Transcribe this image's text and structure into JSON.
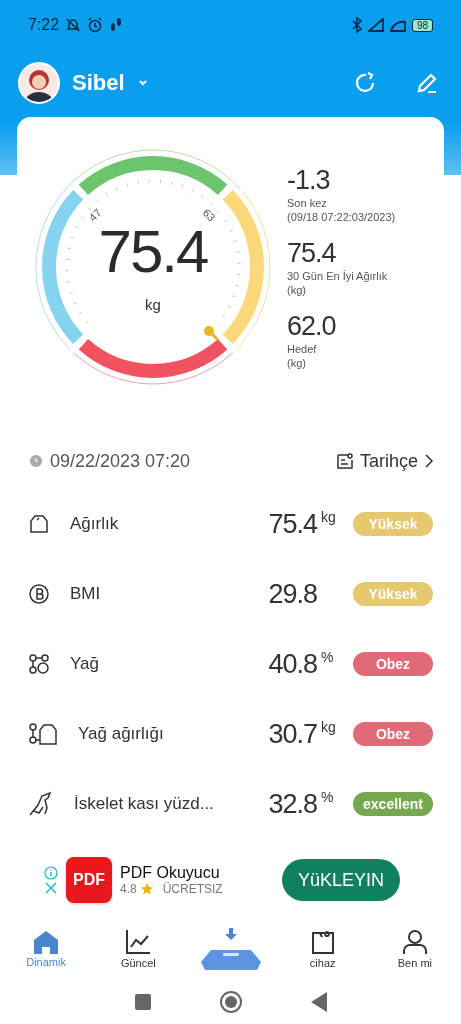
{
  "status_bar": {
    "time": "7:22",
    "battery": "98"
  },
  "header": {
    "user_name": "Sibel"
  },
  "gauge": {
    "value": "75.4",
    "unit": "kg",
    "tick_labels": [
      "47",
      "63"
    ]
  },
  "stats": [
    {
      "value": "-1.3",
      "label": "Son kez",
      "note": "(09/18 07:22:03/2023)"
    },
    {
      "value": "75.4",
      "label": "30 Gün En İyi Ağırlık",
      "note": "(kg)"
    },
    {
      "value": "62.0",
      "label": "Hedef",
      "note": "(kg)"
    }
  ],
  "measurement": {
    "date": "09/22/2023 07:20",
    "history_link": "Tarihçe"
  },
  "metrics": [
    {
      "kind": "weight",
      "label": "Ağırlık",
      "value": "75.4",
      "unit": "kg",
      "badge": "Yüksek",
      "color": "#e6c86e"
    },
    {
      "kind": "bmi",
      "label": "BMI",
      "value": "29.8",
      "badge": "Yüksek",
      "color": "#e6c86e"
    },
    {
      "kind": "fat",
      "label": "Yağ",
      "value": "40.8",
      "unit": "%",
      "badge": "Obez",
      "color": "#e06a76"
    },
    {
      "kind": "fatweight",
      "label": "Yağ ağırlığı",
      "value": "30.7",
      "unit": "kg",
      "badge": "Obez",
      "color": "#e06a76"
    },
    {
      "kind": "muscle",
      "label": "İskelet kası yüzd...",
      "value": "32.8",
      "unit": "%",
      "badge": "excellent",
      "color": "#76a84f"
    }
  ],
  "ad": {
    "app_icon_text": "PDF",
    "title": "PDF Okuyucu",
    "rating": "4.8",
    "price": "ÜCRETSIZ",
    "button": "YüKLEYIN"
  },
  "nav": [
    {
      "kind": "home",
      "label": "Dinamik",
      "selected": true
    },
    {
      "kind": "chart",
      "label": "Güncel",
      "selected": false
    },
    {
      "kind": "scale",
      "selected": false
    },
    {
      "kind": "bag",
      "label": "cihaz",
      "selected": false
    },
    {
      "kind": "person",
      "label": "Ben mi",
      "selected": false
    }
  ]
}
